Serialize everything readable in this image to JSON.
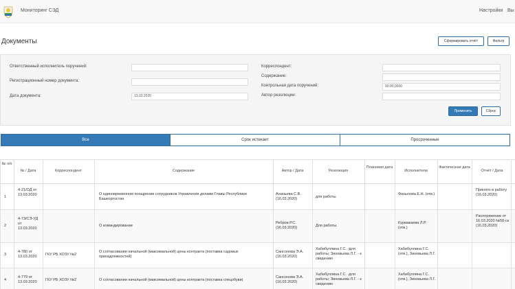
{
  "navbar": {
    "brand": "Мониторинг СЭД",
    "settings": "Настройки",
    "exit": "Вы"
  },
  "page": {
    "title": "Документы",
    "report_button": "Сформировать отчёт",
    "filter_button": "Фильтр"
  },
  "filters": {
    "executor_label": "Ответственный исполнитель поручений:",
    "executor_value": "",
    "regnum_label": "Регистрационный номер документа:",
    "regnum_value": "",
    "docdate_label": "Дата документа:",
    "docdate_value": "13.03.2020",
    "correspondent_label": "Корреспондент:",
    "correspondent_value": "",
    "content_label": "Содержание:",
    "content_value": "",
    "control_date_label": "Контрольная дата поручений:",
    "control_date_value": "00.00.0000",
    "author_label": "Автор резолюции:",
    "author_value": "",
    "apply": "Применить",
    "reset": "Сброс"
  },
  "tabs": [
    "Все",
    "Срок истекает",
    "Просроченные"
  ],
  "table": {
    "headers": {
      "num": "№ п/п",
      "numdate": "№ / Дата",
      "correspondent": "Корреспондент",
      "content": "Содержание",
      "author": "Автор / Дата",
      "resolution": "Резолюция",
      "planned": "Плановая дата",
      "executor": "Исполнители",
      "actual": "Фактическая дата",
      "report": "Отчёт / Дата"
    },
    "rows": [
      {
        "n": "1",
        "numdate": "4-21/ОД от 13.03.2020",
        "correspondent": "",
        "content": "О единовременном поощрении сотрудников Управления делами Главы Республики Башкортостан",
        "author": "Ананьева С.В. (16.03.2020)",
        "resolution": "для работы",
        "planned": "",
        "executor": "Фазылова Е.Н. (отв.)",
        "actual": "",
        "report": "Принято в работу (16.03.2020)"
      },
      {
        "n": "2",
        "numdate": "4-73/СЭ-УД от 13.03.2020",
        "correspondent": "",
        "content": "О командировании",
        "author": "Ребров Р.С. (16.03.2020)",
        "resolution": "Для работы.",
        "planned": "",
        "executor": "Курмакаева Л.Р. (отв.)",
        "actual": "",
        "report": "Распоряжение от 16.03.2020 №58-ск (16.03.2020)"
      },
      {
        "n": "3",
        "numdate": "4-780 от 13.03.2020",
        "correspondent": "ГКУ РБ ХОЗУ №2",
        "content": "О согласовании начальной (максимальной) цены контракта (поставка садовых принадлежностей)",
        "author": "Сансонова Э.А. (16.03.2020)",
        "resolution": "Хабибуллина Г.С. -для работы; Зиновьева Л.Г. - к сведению",
        "planned": "",
        "executor": "Хабибуллина Г.С. (отв.), Зиновьева Л.Г.",
        "actual": "",
        "report": ""
      },
      {
        "n": "4",
        "numdate": "4-779 от 13.03.2020",
        "correspondent": "ГКУ РБ ХОЗУ №2",
        "content": "О согласовании начальной (максимальной) цены контракта (поставка спецобуви)",
        "author": "Сансонова Э.А. (16.03.2020)",
        "resolution": "Хабибуллина Г.С. -для работы; Зиновьева Л.Г. - к сведению",
        "planned": "",
        "executor": "Хабибуллина Г.С. (отв.), Зиновьева Л.Г.",
        "actual": "",
        "report": ""
      }
    ]
  }
}
